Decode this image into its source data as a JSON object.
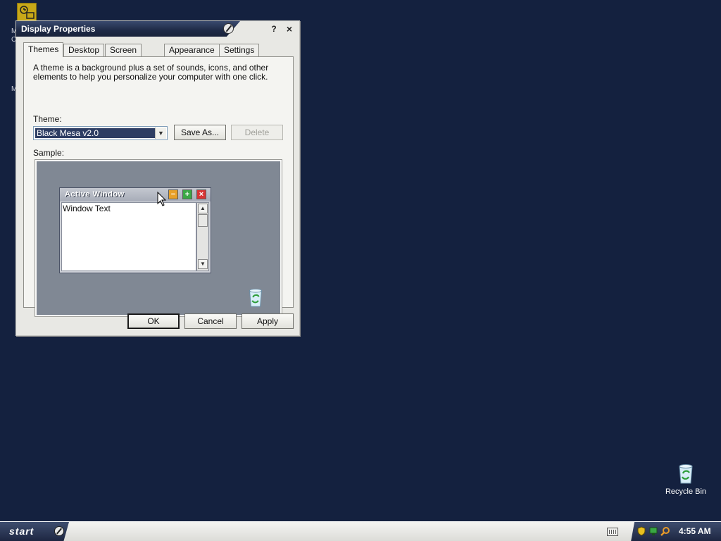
{
  "desktop": {
    "letters": [
      "M",
      "C",
      "M"
    ],
    "recycle_bin_label": "Recycle Bin"
  },
  "window": {
    "title": "Display Properties",
    "help_label": "?",
    "close_label": "×",
    "tabs": [
      {
        "label": "Themes"
      },
      {
        "label": "Desktop"
      },
      {
        "label": "Screen Saver"
      },
      {
        "label": "Appearance"
      },
      {
        "label": "Settings"
      }
    ],
    "active_tab": "Themes",
    "description": "A theme is a background plus a set of sounds, icons, and other elements to help you personalize your computer with one click.",
    "theme_label": "Theme:",
    "theme_value": "Black Mesa v2.0",
    "save_as_label": "Save As...",
    "delete_label": "Delete",
    "sample_label": "Sample:",
    "sample": {
      "window_title": "Active Window",
      "window_text": "Window Text"
    },
    "ok_label": "OK",
    "cancel_label": "Cancel",
    "apply_label": "Apply"
  },
  "taskbar": {
    "start_label": "start",
    "clock": "4:55 AM"
  },
  "colors": {
    "desktop": "#14213f",
    "title_dark": "#1e2a46",
    "selection": "#2d3d63"
  }
}
